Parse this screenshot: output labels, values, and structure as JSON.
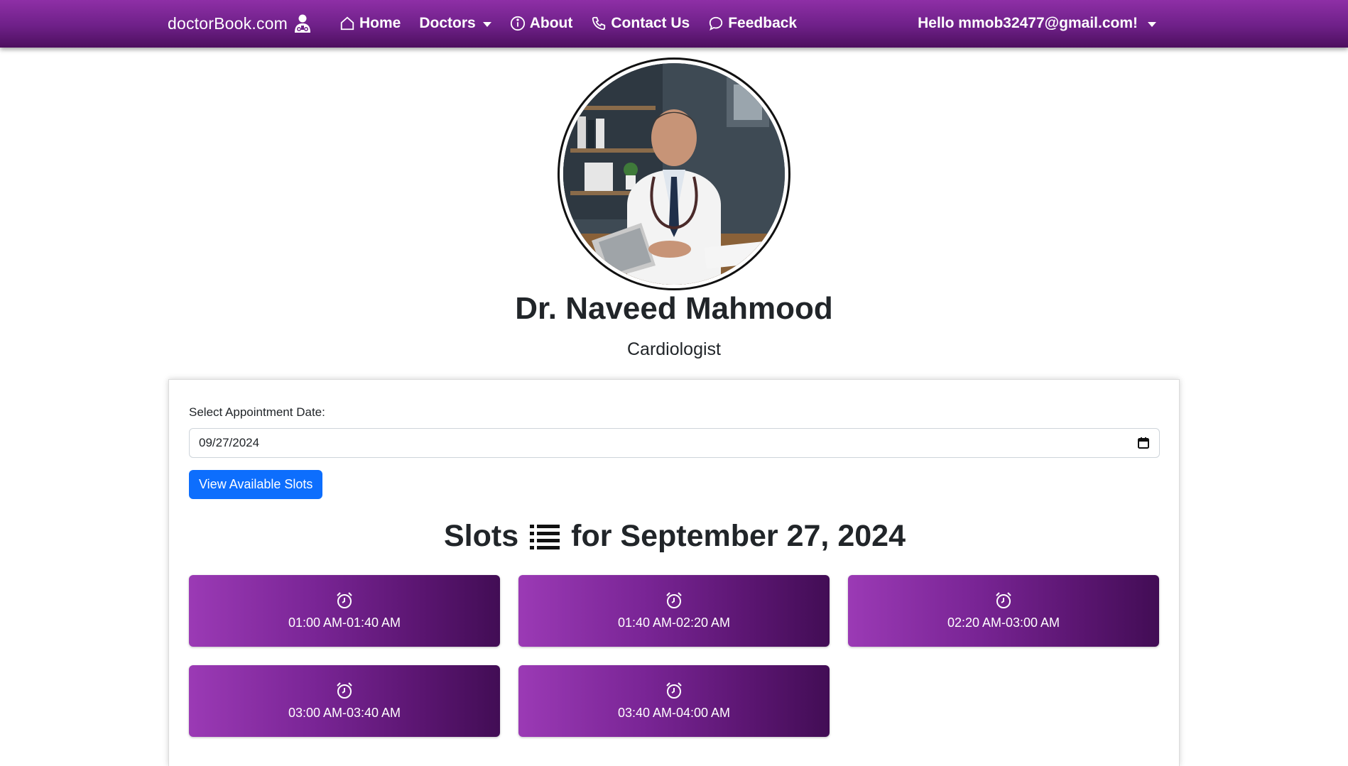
{
  "navbar": {
    "brand": "doctorBook.com",
    "links": [
      {
        "label": "Home",
        "icon": "home-icon"
      },
      {
        "label": "Doctors",
        "icon": "",
        "dropdown": true
      },
      {
        "label": "About",
        "icon": "info-icon"
      },
      {
        "label": "Contact Us",
        "icon": "phone-icon"
      },
      {
        "label": "Feedback",
        "icon": "chat-icon"
      }
    ],
    "user_greeting": "Hello mmob32477@gmail.com!"
  },
  "doctor": {
    "name": "Dr. Naveed Mahmood",
    "specialty": "Cardiologist"
  },
  "booking": {
    "date_label": "Select Appointment Date:",
    "date_value": "09/27/2024",
    "button_label": "View Available Slots",
    "slots_title_prefix": "Slots",
    "slots_title_suffix": "for September 27, 2024",
    "slots": [
      {
        "time": "01:00 AM-01:40 AM"
      },
      {
        "time": "01:40 AM-02:20 AM"
      },
      {
        "time": "02:20 AM-03:00 AM"
      },
      {
        "time": "03:00 AM-03:40 AM"
      },
      {
        "time": "03:40 AM-04:00 AM"
      }
    ]
  },
  "colors": {
    "nav_gradient": [
      "#8e2fa6",
      "#4d0f5e"
    ],
    "slot_gradient": [
      "#9b3ab5",
      "#420d55"
    ],
    "primary_button": "#0d6efd"
  }
}
